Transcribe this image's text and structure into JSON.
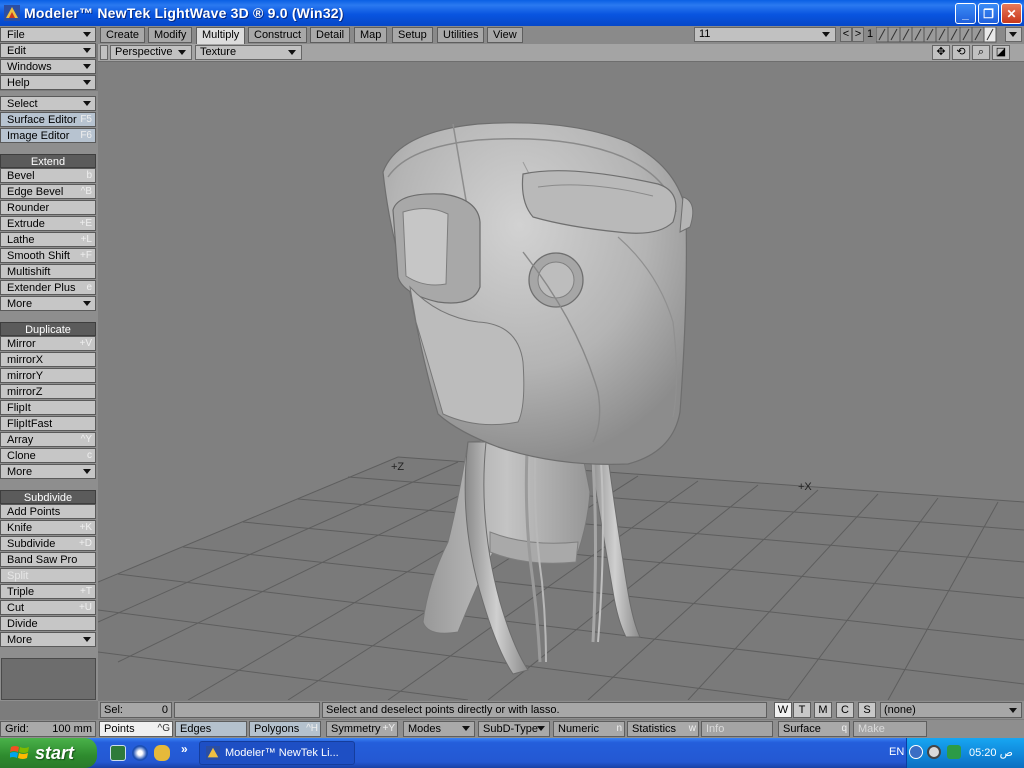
{
  "window": {
    "title": "Modeler™ NewTek LightWave 3D ® 9.0 (Win32)",
    "minimize_glyph": "_",
    "maximize_glyph": "❐",
    "close_glyph": "✕"
  },
  "top_menu": {
    "file": "File",
    "edit": "Edit",
    "windows": "Windows",
    "help": "Help"
  },
  "tabs": [
    {
      "label": "Create"
    },
    {
      "label": "Modify"
    },
    {
      "label": "Multiply",
      "active": true
    },
    {
      "label": "Construct"
    },
    {
      "label": "Detail"
    },
    {
      "label": "Map"
    },
    {
      "label": "Setup"
    },
    {
      "label": "Utilities"
    },
    {
      "label": "View"
    }
  ],
  "layer": {
    "selector_value": "11",
    "nav_prev": "<",
    "nav_next": ">",
    "current": "1"
  },
  "sidebar": {
    "select": "Select",
    "surface_editor": {
      "label": "Surface Editor",
      "shortcut": "F5"
    },
    "image_editor": {
      "label": "Image Editor",
      "shortcut": "F6"
    },
    "extend_header": "Extend",
    "extend": [
      {
        "label": "Bevel",
        "shortcut": "b"
      },
      {
        "label": "Edge Bevel",
        "shortcut": "^B"
      },
      {
        "label": "Rounder",
        "shortcut": ""
      },
      {
        "label": "Extrude",
        "shortcut": "+E"
      },
      {
        "label": "Lathe",
        "shortcut": "+L"
      },
      {
        "label": "Smooth Shift",
        "shortcut": "+F"
      },
      {
        "label": "Multishift",
        "shortcut": ""
      },
      {
        "label": "Extender Plus",
        "shortcut": "e"
      },
      {
        "label": "More",
        "shortcut": ""
      }
    ],
    "duplicate_header": "Duplicate",
    "duplicate": [
      {
        "label": "Mirror",
        "shortcut": "+V"
      },
      {
        "label": "mirrorX",
        "shortcut": ""
      },
      {
        "label": "mirrorY",
        "shortcut": ""
      },
      {
        "label": "mirrorZ",
        "shortcut": ""
      },
      {
        "label": "FlipIt",
        "shortcut": ""
      },
      {
        "label": "FlipItFast",
        "shortcut": ""
      },
      {
        "label": "Array",
        "shortcut": "^Y"
      },
      {
        "label": "Clone",
        "shortcut": "c"
      },
      {
        "label": "More",
        "shortcut": ""
      }
    ],
    "subdivide_header": "Subdivide",
    "subdivide": [
      {
        "label": "Add Points",
        "shortcut": ""
      },
      {
        "label": "Knife",
        "shortcut": "+K"
      },
      {
        "label": "Subdivide",
        "shortcut": "+D"
      },
      {
        "label": "Band Saw Pro",
        "shortcut": ""
      },
      {
        "label": "Split",
        "shortcut": ""
      },
      {
        "label": "Triple",
        "shortcut": "+T"
      },
      {
        "label": "Cut",
        "shortcut": "+U"
      },
      {
        "label": "Divide",
        "shortcut": ""
      },
      {
        "label": "More",
        "shortcut": ""
      }
    ]
  },
  "viewport": {
    "view_mode": "Perspective",
    "render_mode": "Texture",
    "tools": [
      "✥",
      "⟲",
      "⌕",
      "◪"
    ],
    "axis_z": "+Z",
    "axis_x": "+X"
  },
  "status": {
    "sel_label": "Sel:",
    "sel_value": "0",
    "message": "Select and deselect points directly or with lasso.",
    "wtmcs": [
      "W",
      "T",
      "M",
      "C",
      "S"
    ],
    "vmap_value": "(none)"
  },
  "bottom": {
    "grid_label": "Grid:",
    "grid_value": "100 mm",
    "points": {
      "label": "Points",
      "shortcut": "^G"
    },
    "edges": "Edges",
    "polygons": {
      "label": "Polygons",
      "shortcut": "^H"
    },
    "symmetry": {
      "label": "Symmetry",
      "shortcut": "+Y"
    },
    "modes": "Modes",
    "subd_type": "SubD-Type",
    "numeric": {
      "label": "Numeric",
      "shortcut": "n"
    },
    "statistics": {
      "label": "Statistics",
      "shortcut": "w"
    },
    "info": "Info",
    "surface": {
      "label": "Surface",
      "shortcut": "q"
    },
    "make": "Make"
  },
  "taskbar": {
    "start": "start",
    "chevron": "»",
    "task": "Modeler™ NewTek Li...",
    "lang": "EN",
    "time": "05:20 ص"
  },
  "colors": {
    "titlebar": "#0a5fe4",
    "viewport_bg": "#808080",
    "panel_gray": "#c6c6c6",
    "header_dark": "#5b5b5b",
    "start_green": "#2e8b2e"
  }
}
